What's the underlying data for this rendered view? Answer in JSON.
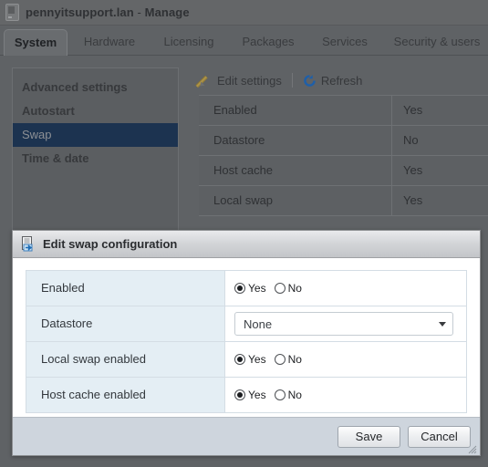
{
  "window": {
    "icon": "host-icon",
    "host": "pennyitsupport.lan",
    "separator": " - ",
    "action": "Manage"
  },
  "tabs": [
    {
      "label": "System",
      "active": true
    },
    {
      "label": "Hardware",
      "active": false
    },
    {
      "label": "Licensing",
      "active": false
    },
    {
      "label": "Packages",
      "active": false
    },
    {
      "label": "Services",
      "active": false
    },
    {
      "label": "Security & users",
      "active": false
    }
  ],
  "sidebar": {
    "items": [
      {
        "label": "Advanced settings",
        "selected": false
      },
      {
        "label": "Autostart",
        "selected": false
      },
      {
        "label": "Swap",
        "selected": true
      },
      {
        "label": "Time & date",
        "selected": false
      }
    ]
  },
  "toolbar": {
    "edit_settings_label": "Edit settings",
    "edit_settings_icon": "pencil-icon",
    "refresh_label": "Refresh",
    "refresh_icon": "refresh-icon"
  },
  "main_table": {
    "rows": [
      {
        "label": "Enabled",
        "value": "Yes"
      },
      {
        "label": "Datastore",
        "value": "No"
      },
      {
        "label": "Host cache",
        "value": "Yes"
      },
      {
        "label": "Local swap",
        "value": "Yes"
      }
    ]
  },
  "dialog": {
    "icon": "edit-document-icon",
    "title": "Edit swap configuration",
    "rows": [
      {
        "label": "Enabled",
        "type": "radio",
        "options": [
          {
            "label": "Yes",
            "checked": true
          },
          {
            "label": "No",
            "checked": false
          }
        ]
      },
      {
        "label": "Datastore",
        "type": "select",
        "value": "None"
      },
      {
        "label": "Local swap enabled",
        "type": "radio",
        "options": [
          {
            "label": "Yes",
            "checked": true
          },
          {
            "label": "No",
            "checked": false
          }
        ]
      },
      {
        "label": "Host cache enabled",
        "type": "radio",
        "options": [
          {
            "label": "Yes",
            "checked": true
          },
          {
            "label": "No",
            "checked": false
          }
        ]
      }
    ],
    "footer": {
      "save_label": "Save",
      "cancel_label": "Cancel",
      "resize_grip_icon": "resize-grip-icon"
    }
  },
  "colors": {
    "selection": "#1c3350",
    "dialog_label_bg": "#e4eef4",
    "footer_bg": "#ced5dd",
    "refresh_blue": "#1f5fa8",
    "pencil_gold": "#b49a4c"
  }
}
